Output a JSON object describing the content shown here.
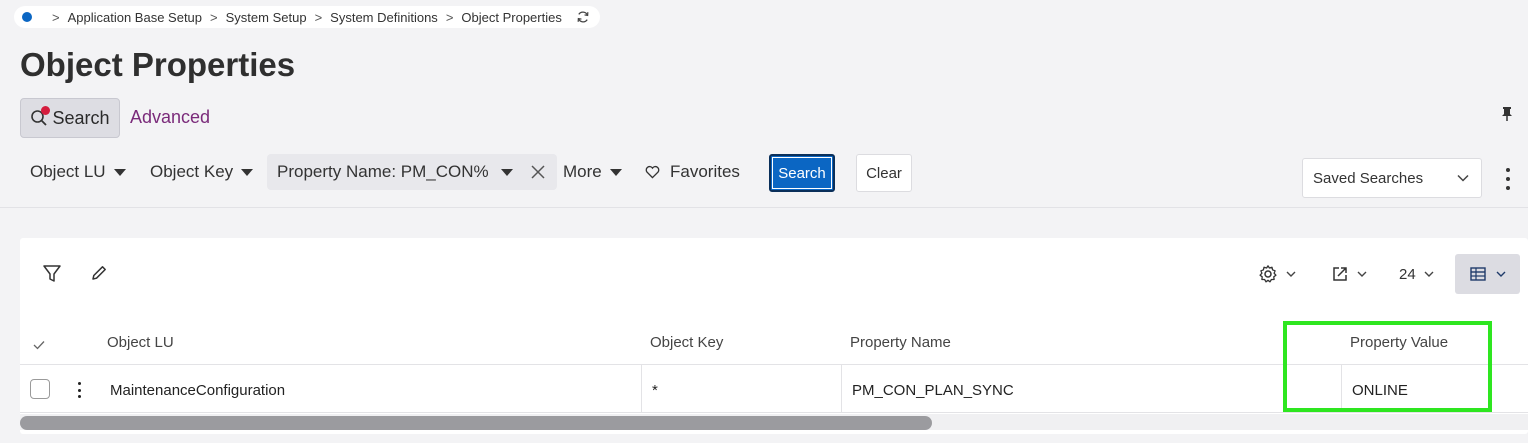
{
  "breadcrumb": {
    "items": [
      "Application Base Setup",
      "System Setup",
      "System Definitions",
      "Object Properties"
    ],
    "refresh_icon": "refresh-icon"
  },
  "page": {
    "title": "Object Properties"
  },
  "mode_tabs": {
    "search": "Search",
    "advanced": "Advanced"
  },
  "filters": {
    "object_lu": "Object LU",
    "object_key": "Object Key",
    "property_name": "Property Name: PM_CON%",
    "more": "More",
    "favorites": "Favorites",
    "search_button": "Search",
    "clear_button": "Clear",
    "saved_searches": "Saved Searches"
  },
  "toolbar": {
    "page_size": "24"
  },
  "table": {
    "columns": [
      "Object LU",
      "Object Key",
      "Property Name",
      "Property Value"
    ],
    "rows": [
      {
        "object_lu": "MaintenanceConfiguration",
        "object_key": "*",
        "property_name": "PM_CON_PLAN_SYNC",
        "property_value": "ONLINE"
      }
    ]
  },
  "colors": {
    "primary": "#0b66c3",
    "highlight": "#2ee620",
    "advanced_link": "#7a2a7a",
    "search_badge": "#d51d3e"
  }
}
